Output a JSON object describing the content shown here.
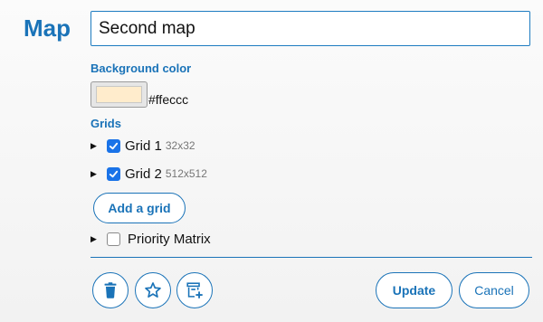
{
  "header": {
    "title": "Map",
    "name_value": "Second map"
  },
  "background": {
    "label": "Background color",
    "color_hex": "#ffeccc",
    "color_text": "#ffeccc"
  },
  "grids": {
    "label": "Grids",
    "items": [
      {
        "name": "Grid 1",
        "size": "32x32",
        "checked": true
      },
      {
        "name": "Grid 2",
        "size": "512x512",
        "checked": true
      }
    ],
    "add_label": "Add a grid"
  },
  "priority": {
    "name": "Priority Matrix",
    "checked": false
  },
  "footer": {
    "update_label": "Update",
    "cancel_label": "Cancel",
    "icons": [
      "trash-icon",
      "star-icon",
      "add-layer-icon"
    ]
  },
  "colors": {
    "accent": "#1a73b8",
    "checkbox": "#1a73e8"
  }
}
